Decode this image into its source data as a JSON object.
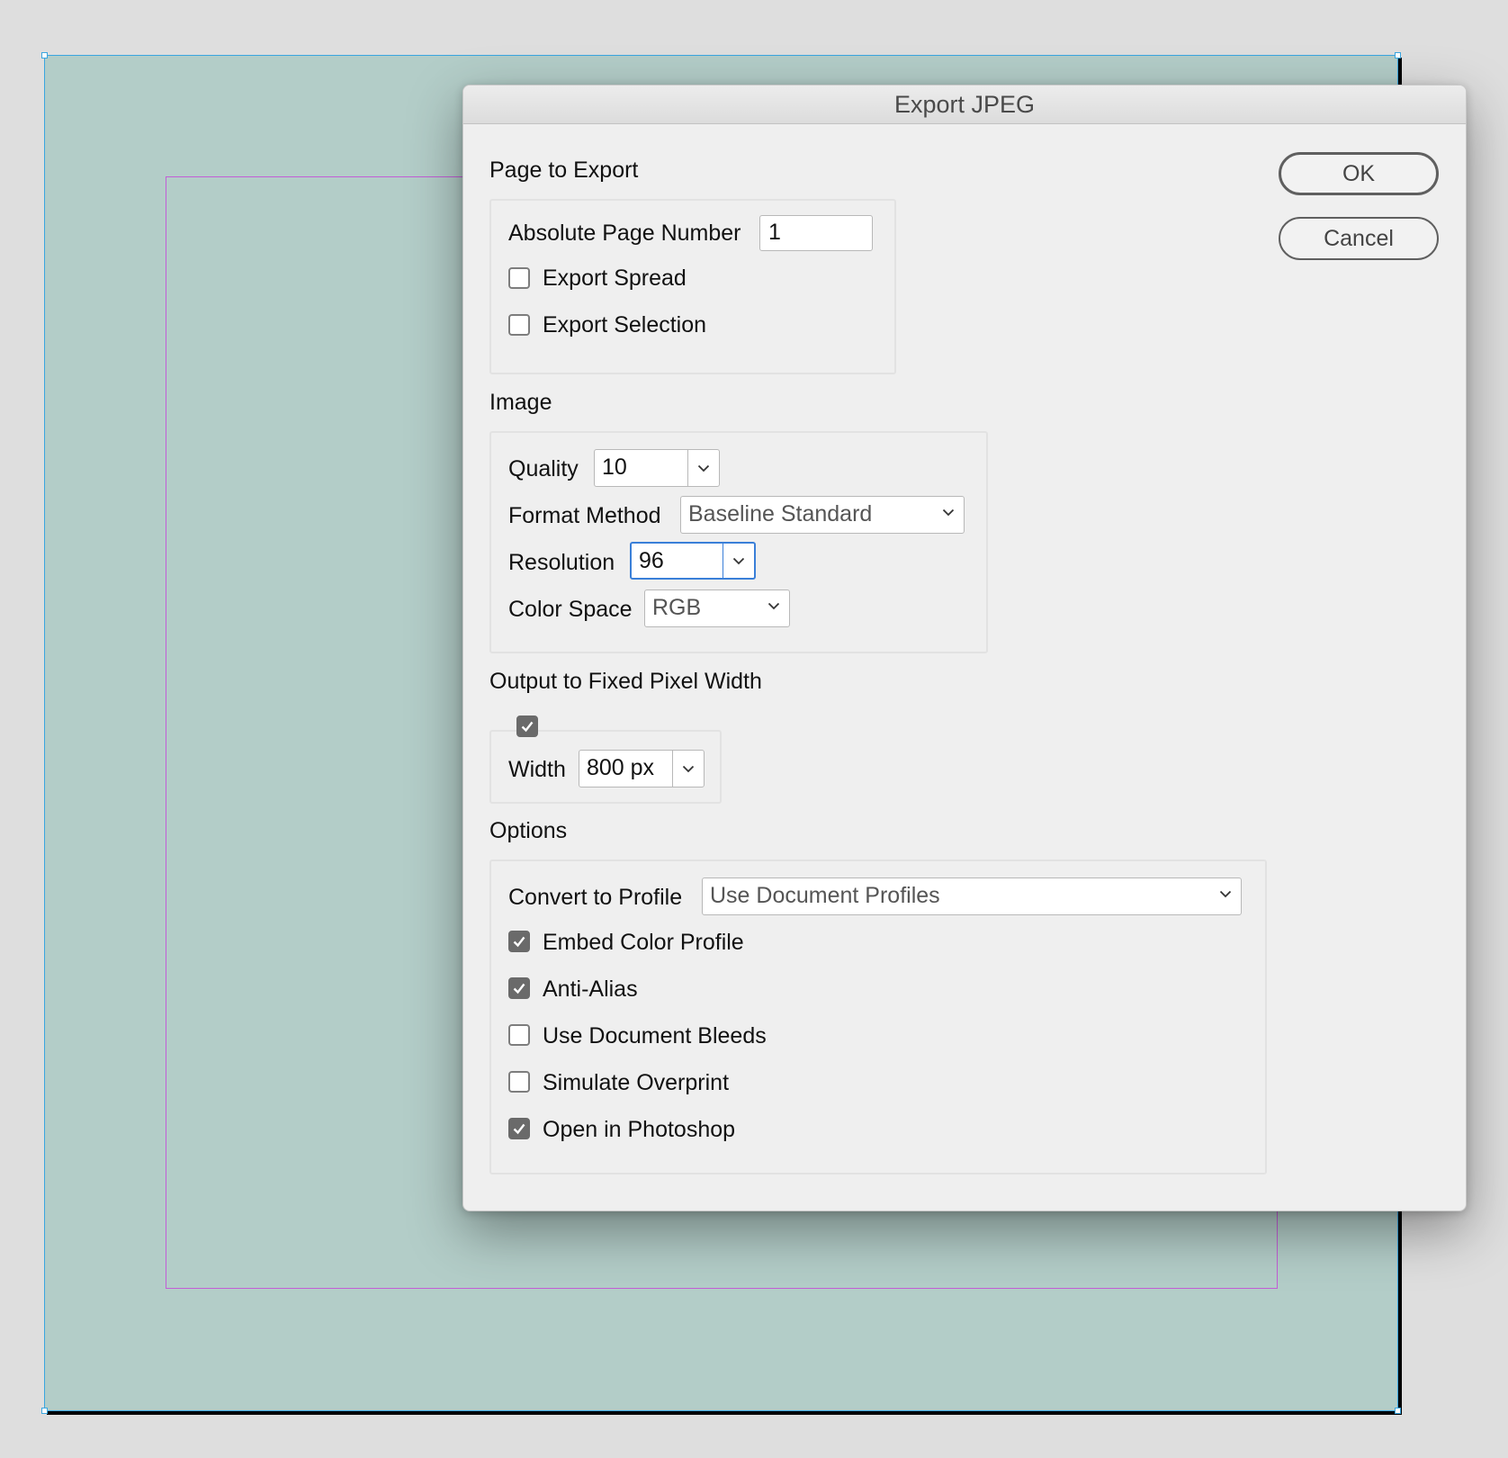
{
  "dialog": {
    "title": "Export JPEG",
    "ok_label": "OK",
    "cancel_label": "Cancel"
  },
  "page_to_export": {
    "heading": "Page to Export",
    "absolute_page_number_label": "Absolute Page Number",
    "absolute_page_number_value": "1",
    "export_spread_label": "Export Spread",
    "export_spread_checked": false,
    "export_selection_label": "Export Selection",
    "export_selection_checked": false
  },
  "image": {
    "heading": "Image",
    "quality_label": "Quality",
    "quality_value": "10",
    "format_method_label": "Format Method",
    "format_method_value": "Baseline Standard",
    "resolution_label": "Resolution",
    "resolution_value": "96",
    "color_space_label": "Color Space",
    "color_space_value": "RGB"
  },
  "fixed_width": {
    "heading": "Output to Fixed Pixel Width",
    "enabled": true,
    "width_label": "Width",
    "width_value": "800 px"
  },
  "options": {
    "heading": "Options",
    "convert_to_profile_label": "Convert to Profile",
    "convert_to_profile_value": "Use Document Profiles",
    "embed_color_profile_label": "Embed Color Profile",
    "embed_color_profile_checked": true,
    "anti_alias_label": "Anti-Alias",
    "anti_alias_checked": true,
    "use_document_bleeds_label": "Use Document Bleeds",
    "use_document_bleeds_checked": false,
    "simulate_overprint_label": "Simulate Overprint",
    "simulate_overprint_checked": false,
    "open_in_photoshop_label": "Open in Photoshop",
    "open_in_photoshop_checked": true
  },
  "colors": {
    "page_background": "#b3cdc8",
    "selection_frame": "#3aa6e0",
    "margin_guide": "#c25ed6",
    "focus_ring": "#3a7fd8"
  }
}
